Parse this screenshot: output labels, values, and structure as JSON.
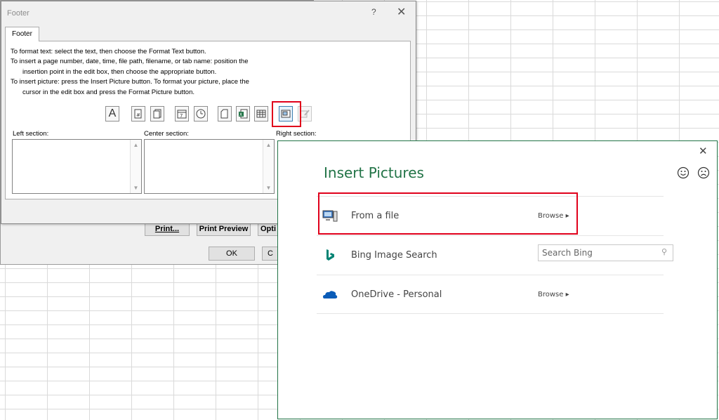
{
  "footer_dialog": {
    "title": "Footer",
    "help": "?",
    "close": "✕",
    "tab_label": "Footer",
    "instructions": [
      "To format text:  select the text, then choose the Format Text button.",
      "To insert a page number, date, time, file path, filename, or tab name:  position the",
      "insertion point in the edit box, then choose the appropriate button.",
      "To insert picture: press the Insert Picture button.  To format your picture, place the",
      "cursor in the edit box and press the Format Picture button."
    ],
    "toolbar_buttons": [
      "format-text",
      "insert-page-number",
      "insert-number-of-pages",
      "insert-date",
      "insert-time",
      "insert-file-path",
      "insert-file-name",
      "insert-sheet-name",
      "insert-picture",
      "format-picture"
    ],
    "sections": {
      "left": "Left section:",
      "center": "Center section:",
      "right": "Right section:"
    }
  },
  "page_setup": {
    "print_label": "Print...",
    "print_preview_label": "Print Preview",
    "options_label": "Opti",
    "ok_label": "OK",
    "cancel_label": "C"
  },
  "insert_pictures": {
    "title": "Insert Pictures",
    "close": "✕",
    "rows": [
      {
        "label": "From a file",
        "action": "Browse ▸",
        "icon": "computer-icon"
      },
      {
        "label": "Bing Image Search",
        "search_placeholder": "Search Bing",
        "icon": "bing-icon"
      },
      {
        "label": "OneDrive - Personal",
        "action": "Browse ▸",
        "icon": "onedrive-icon"
      }
    ]
  },
  "colors": {
    "accent_green": "#217346",
    "highlight_red": "#e0001b",
    "onedrive_blue": "#0a5cb8",
    "bing_teal": "#008373"
  }
}
